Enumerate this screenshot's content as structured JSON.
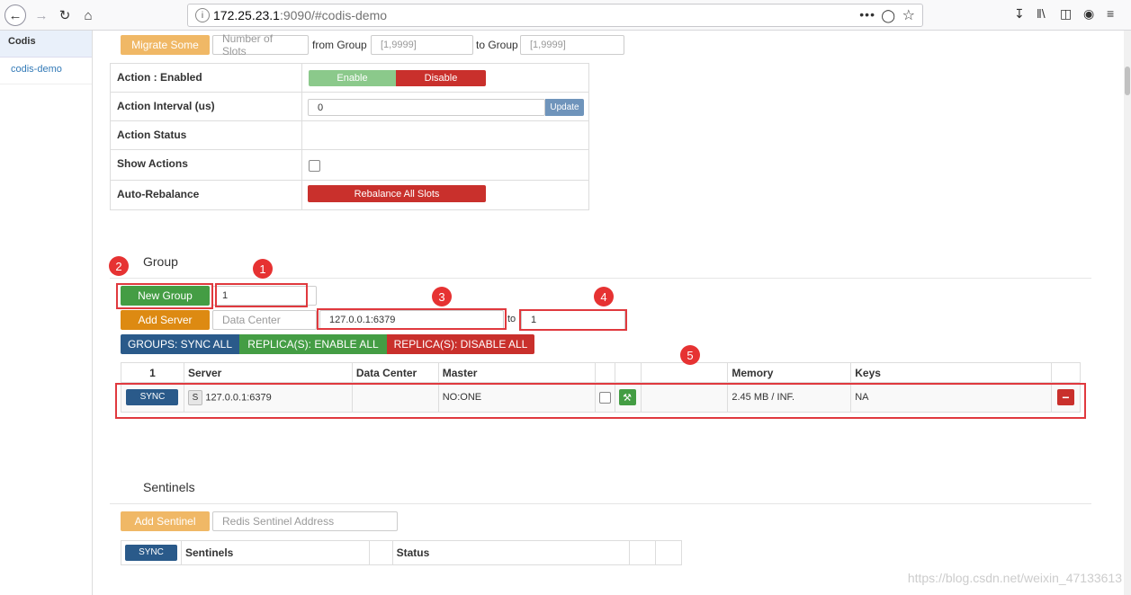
{
  "browser": {
    "url_host": "172.25.23.1",
    "url_rest": ":9090/#codis-demo",
    "dots": "•••"
  },
  "sidebar": {
    "header": "Codis",
    "items": [
      {
        "label": "codis-demo"
      }
    ]
  },
  "migrate": {
    "button": "Migrate Some",
    "slots_placeholder": "Number of Slots",
    "from_label": "from Group",
    "from_placeholder": "[1,9999]",
    "to_label": "to Group",
    "to_placeholder": "[1,9999]"
  },
  "actions": {
    "rows": [
      {
        "label": "Action : Enabled"
      },
      {
        "label": "Action Interval (us)"
      },
      {
        "label": "Action Status"
      },
      {
        "label": "Show Actions"
      },
      {
        "label": "Auto-Rebalance"
      }
    ],
    "enable_label": "Enable",
    "disable_label": "Disable",
    "interval_value": "0",
    "update_label": "Update",
    "rebalance_label": "Rebalance All Slots"
  },
  "group": {
    "title": "Group",
    "new_group_label": "New Group",
    "group_id_value": "1",
    "add_server_label": "Add Server",
    "datacenter_placeholder": "Data Center",
    "server_addr_value": "127.0.0.1:6379",
    "to_label": "to",
    "to_group_value": "1",
    "sync_all_label": "GROUPS: SYNC ALL",
    "replica_enable_label": "REPLICA(S): ENABLE ALL",
    "replica_disable_label": "REPLICA(S): DISABLE ALL",
    "table": {
      "headers": [
        "1",
        "Server",
        "Data Center",
        "Master",
        "",
        "",
        "",
        "Memory",
        "Keys",
        ""
      ],
      "row": {
        "sync_label": "SYNC",
        "server_badge": "S",
        "server": "127.0.0.1:6379",
        "data_center": "",
        "master": "NO:ONE",
        "memory": "2.45 MB / INF.",
        "keys": "NA"
      }
    }
  },
  "sentinels": {
    "title": "Sentinels",
    "add_label": "Add Sentinel",
    "address_placeholder": "Redis Sentinel Address",
    "table": {
      "sync_label": "SYNC",
      "headers": [
        "Sentinels",
        "Status"
      ]
    }
  },
  "annotations": [
    "1",
    "2",
    "3",
    "4",
    "5"
  ],
  "watermark": "https://blog.csdn.net/weixin_47133613",
  "colors": {
    "orange": "#f0ad4e",
    "green": "#449d44",
    "red": "#c9302c",
    "navy": "#2a5a8a",
    "light_green": "#8bc98b",
    "update_blue": "#6f94bb",
    "marker": "#e63232"
  }
}
